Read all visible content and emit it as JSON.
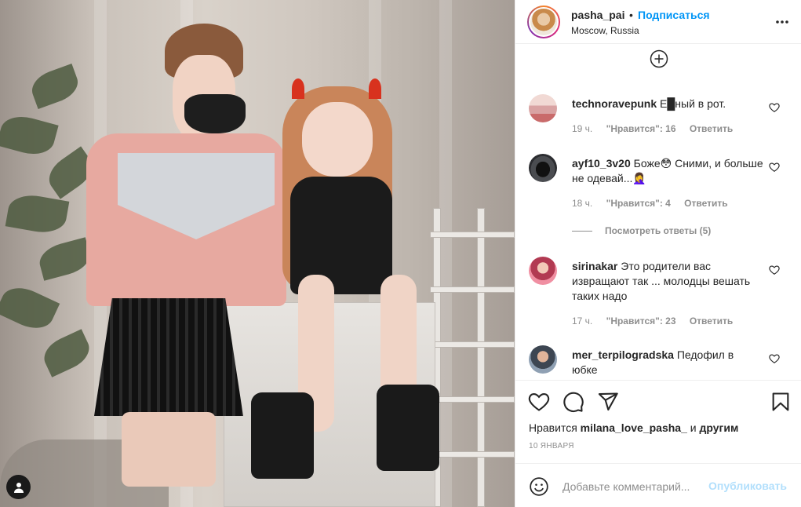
{
  "post": {
    "username": "pasha_pai",
    "separator": "•",
    "follow_label": "Подписаться",
    "location": "Moscow, Russia"
  },
  "comments": [
    {
      "username": "technoravepunk",
      "text": "Е█ный в рот.",
      "time": "19 ч.",
      "likes": "\"Нравится\": 16",
      "reply": "Ответить",
      "avatar_color": "#e8c4c4"
    },
    {
      "username": "ayf10_3v20",
      "text": "Боже😳 Сними, и больше не одевай...🤦‍♀️",
      "time": "18 ч.",
      "likes": "\"Нравится\": 4",
      "reply": "Ответить",
      "avatar_color": "#2e2f33"
    },
    {
      "username": "sirinakar",
      "text": "Это родители вас извращают так ... молодцы вешать таких надо",
      "time": "17 ч.",
      "likes": "\"Нравится\": 23",
      "reply": "Ответить",
      "avatar_color": "#d96a7a"
    },
    {
      "username": "mer_terpilogradska",
      "text": "Педофил в юбке",
      "avatar_color": "#6b7b8c"
    }
  ],
  "view_replies": "Посмотреть ответы (5)",
  "likes_line": {
    "prefix": "Нравится",
    "user": "milana_love_pasha_",
    "suffix": "и",
    "others": "другим"
  },
  "date": "10 ЯНВАРЯ",
  "comment_box": {
    "placeholder": "Добавьте комментарий...",
    "publish_label": "Опубликовать"
  },
  "colors": {
    "accent": "#0095f6",
    "publish_disabled": "#b2dffc",
    "muted": "#8e8e8e"
  },
  "icons": [
    "more-options-icon",
    "load-more-icon",
    "heart-icon",
    "comment-icon",
    "share-icon",
    "bookmark-icon",
    "emoji-icon",
    "user-tag-icon"
  ]
}
